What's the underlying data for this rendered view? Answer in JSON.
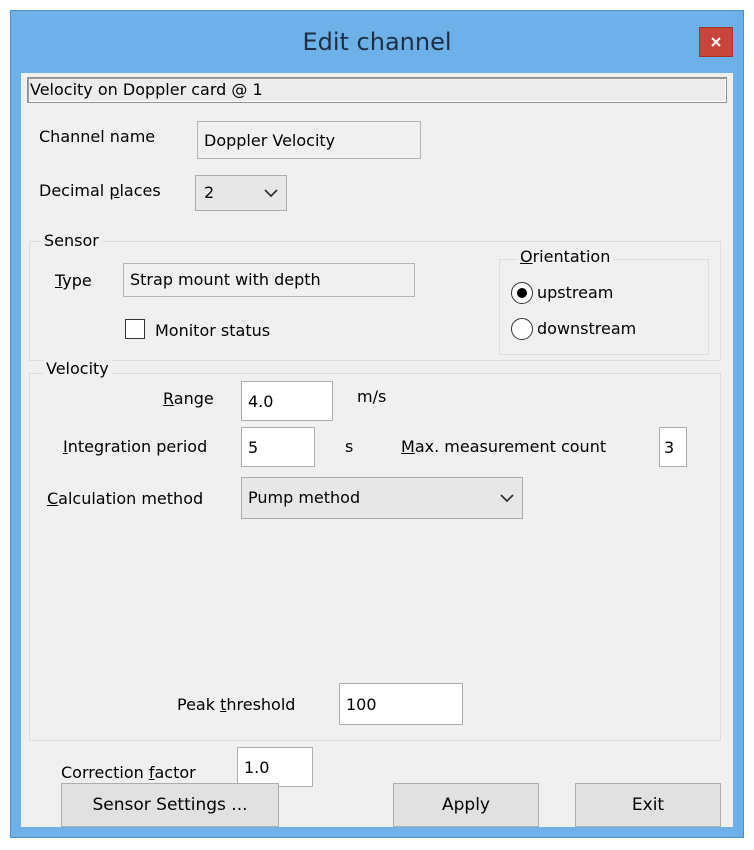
{
  "window": {
    "title": "Edit channel",
    "close_glyph": "×",
    "close_color": "#c7453b"
  },
  "header": {
    "text": "Velocity on Doppler card @ 1"
  },
  "channel_name": {
    "label": "Channel name",
    "value": "Doppler Velocity"
  },
  "decimal_places": {
    "label_pre": "Decimal ",
    "label_mnemonic": "p",
    "label_post": "laces",
    "value": "2"
  },
  "sensor": {
    "group_label": "Sensor",
    "type_label_mnemonic": "T",
    "type_label_rest": "ype",
    "type_value": "Strap mount with depth",
    "monitor_label": "Monitor status",
    "monitor_checked": false,
    "orientation": {
      "label_mnemonic": "O",
      "label_rest": "rientation",
      "options": [
        "upstream",
        "downstream"
      ],
      "selected": "upstream"
    }
  },
  "velocity": {
    "group_label": "Velocity",
    "range_label_mnemonic": "R",
    "range_label_rest": "ange",
    "range_value": "4.0",
    "range_unit": "m/s",
    "integration_label_mnemonic": "I",
    "integration_label_rest": "ntegration period",
    "integration_value": "5",
    "integration_unit": "s",
    "max_label_mnemonic": "M",
    "max_label_rest": "ax. measurement count",
    "max_value": "3",
    "calc_label_mnemonic": "C",
    "calc_label_rest": "alculation method",
    "calc_value": "Pump method",
    "peak_label_pre": "Peak ",
    "peak_label_mnemonic": "t",
    "peak_label_post": "hreshold",
    "peak_value": "100"
  },
  "correction": {
    "label_pre": "Correction ",
    "label_mnemonic": "f",
    "label_post": "actor",
    "value": "1.0"
  },
  "buttons": {
    "sensor_settings": "Sensor Settings ...",
    "apply": "Apply",
    "exit": "Exit"
  },
  "icons": {
    "chevron": "chevron-down-icon",
    "close": "close-icon"
  },
  "colors": {
    "titlebar": "#6eb0e8",
    "client": "#f0f0f0"
  }
}
